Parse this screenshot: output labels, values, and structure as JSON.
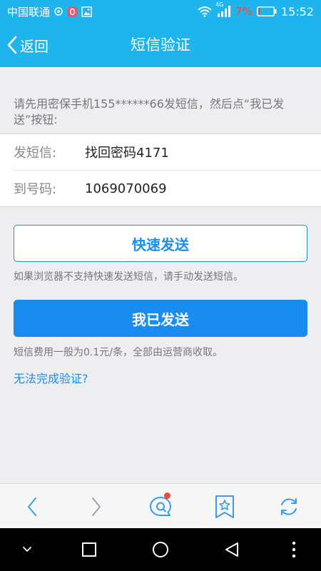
{
  "status_bar": {
    "carrier": "中国联通",
    "network_label": "4G",
    "battery_percent": "7%",
    "time": "15:52",
    "colors": {
      "background": "#1eb4ee",
      "battery_warning": "#f0463c"
    }
  },
  "nav": {
    "back_label": "返回",
    "title": "短信验证"
  },
  "notice": "请先用密保手机155******66发短信，然后点“我已发送”按钮:",
  "info_rows": [
    {
      "label": "发短信:",
      "value": "找回密码4171"
    },
    {
      "label": "到号码:",
      "value": "1069070069"
    }
  ],
  "buttons": {
    "quick_send": "快速发送",
    "sent": "我已发送"
  },
  "hint": "如果浏览器不支持快速发送短信，请手动发送短信。",
  "fee_note": "短信费用一般为0.1元/条，全部由运营商收取。",
  "cannot_verify_link": "无法完成验证?",
  "toolbar": {
    "icons": [
      "back-arrow-icon",
      "forward-arrow-icon",
      "chat-bubble-icon",
      "bookmark-star-icon",
      "refresh-icon"
    ],
    "accent_color": "#1a8cf0"
  }
}
